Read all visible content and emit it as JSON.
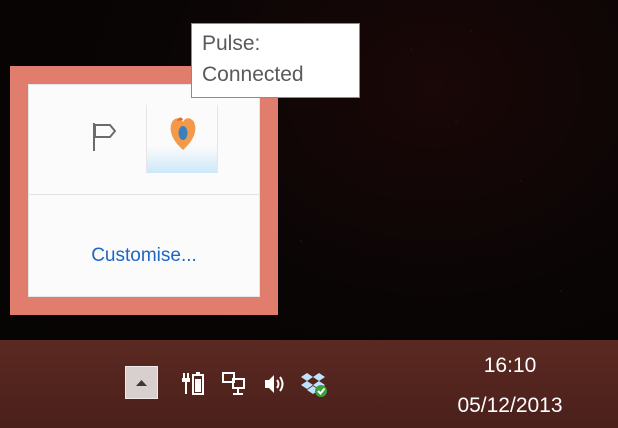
{
  "tooltip": {
    "line1": "Pulse:",
    "line2": "Connected"
  },
  "overflow_panel": {
    "icons": [
      {
        "name": "action-center-flag-icon"
      },
      {
        "name": "pulse-icon"
      }
    ],
    "customise_label": "Customise..."
  },
  "taskbar": {
    "tray_icons": [
      {
        "name": "show-hidden-icons-chevron"
      },
      {
        "name": "power-battery-icon"
      },
      {
        "name": "network-icon"
      },
      {
        "name": "volume-icon"
      },
      {
        "name": "dropbox-icon"
      }
    ],
    "clock": {
      "time": "16:10",
      "date": "05/12/2013"
    }
  },
  "colors": {
    "panel_highlight": "#e07d6c",
    "taskbar": "#532520",
    "link": "#1f66c2",
    "dropbox_check": "#3aa13a"
  }
}
